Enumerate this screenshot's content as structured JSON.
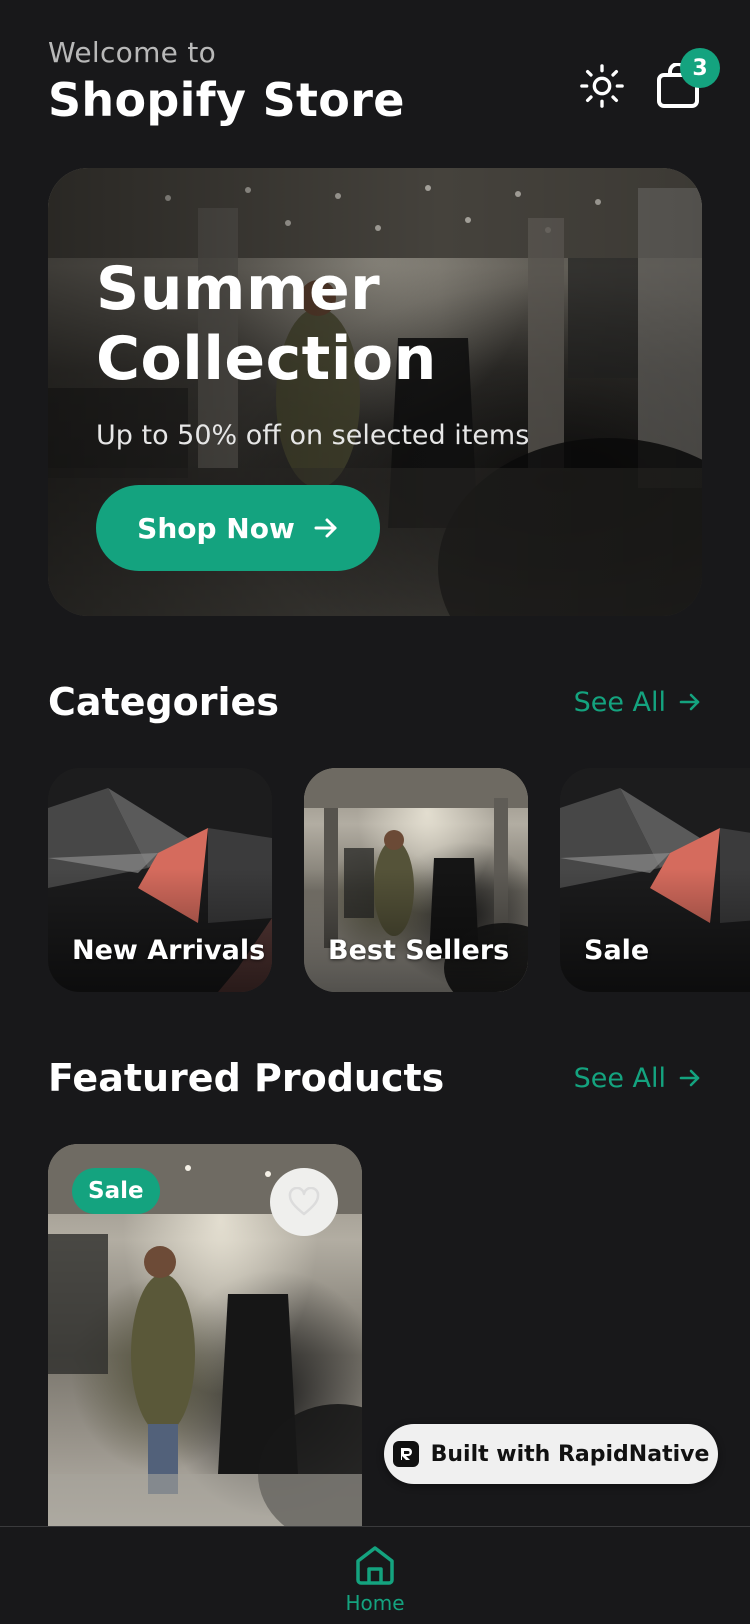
{
  "header": {
    "welcome": "Welcome to",
    "store_name": "Shopify Store",
    "cart_count": "3",
    "theme_icon": "sun-icon",
    "cart_icon": "shopping-bag-icon"
  },
  "hero": {
    "title_line1": "Summer",
    "title_line2": "Collection",
    "subtitle": "Up to 50% off on selected items",
    "cta_label": "Shop Now"
  },
  "categories": {
    "title": "Categories",
    "see_all": "See All",
    "items": [
      {
        "label": "New Arrivals",
        "image": "abstract-shapes"
      },
      {
        "label": "Best Sellers",
        "image": "store-interior"
      },
      {
        "label": "Sale",
        "image": "abstract-shapes"
      }
    ]
  },
  "featured": {
    "title": "Featured Products",
    "see_all": "See All",
    "products": [
      {
        "badge": "Sale",
        "image": "store-interior"
      }
    ]
  },
  "built_with": {
    "label": "Built with RapidNative"
  },
  "nav": {
    "items": [
      {
        "label": "Home",
        "icon": "home-icon",
        "active": true
      }
    ]
  },
  "colors": {
    "background": "#18181a",
    "accent": "#14a37f",
    "text": "#ffffff",
    "muted": "#b8b8b8"
  }
}
